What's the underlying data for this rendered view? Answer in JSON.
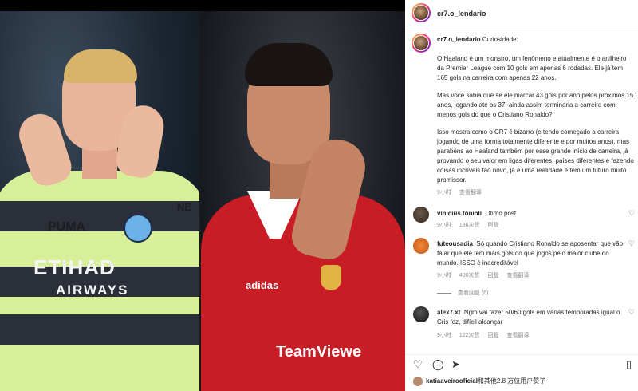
{
  "post": {
    "username": "cr7.o_lendario",
    "caption_title": "Curiosidade:",
    "caption_p1": "O Haaland é um monstro, um fenômeno e atualmente é o artilheiro da Premier League com 10 gols em apenas 6 rodadas. Ele já tem 165 gols na carreira com apenas 22 anos.",
    "caption_p2": "Mas você sabia que se ele marcar 43 gols por ano pelos próximos 15 anos, jogando até os 37, ainda assim terminaria a carreira com menos gols do que o Cristiano Ronaldo?",
    "caption_p3": "Isso mostra como o CR7 é bizarro (e tendo começado a carreira jogando de uma forma totalmente diferente e por muitos anos), mas parabéns ao Haaland também por esse grande início de carreira, já provando o seu valor em ligas diferentes, países diferentes e fazendo coisas incríveis tão novo, já é uma realidade e tem um futuro muito promissor.",
    "caption_time": "9小时",
    "caption_translate": "查看翻译"
  },
  "photo": {
    "left_sponsor": "ETIHAD",
    "left_sponsor_sub": "AIRWAYS",
    "left_brand": "PUMA",
    "left_sleeve": "NE",
    "right_sponsor": "TeamViewe",
    "right_brand": "adidas"
  },
  "comments": [
    {
      "user": "vinicius.tonioli",
      "text": "Otimo post",
      "time": "9小时",
      "likes": "136次赞",
      "reply": "回复"
    },
    {
      "user": "futeousadia",
      "text": "Só quando Cristiano Ronaldo se aposentar que vão falar que ele tem mais gols do que jogos pelo maior clube do mundo. ISSO é inacreditável",
      "time": "9小时",
      "likes": "400次赞",
      "reply": "回复",
      "translate": "查看翻译",
      "view_replies": "查看回复 (6)"
    },
    {
      "user": "alex7.xt",
      "text": "Ngm vai fazer 50/60 gols em várias temporadas igual o Cris fez, difícil alcançar",
      "time": "9小时",
      "likes": "122次赞",
      "reply": "回复",
      "translate": "查看翻译"
    }
  ],
  "footer": {
    "liked_by_user": "katiaaveirooficial",
    "liked_by_rest": "和其他2.8 万位用户赞了"
  },
  "icons": [
    "heart-icon",
    "comment-icon",
    "share-icon",
    "bookmark-icon"
  ]
}
